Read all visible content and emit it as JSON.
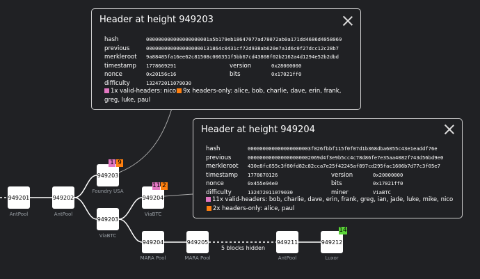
{
  "colors": {
    "pink": "#e377c2",
    "orange": "#ff7f0e",
    "green": "#5cd63a",
    "bg": "#202124"
  },
  "nodes": [
    {
      "id": "n1",
      "height": "949201",
      "miner": "AntPool"
    },
    {
      "id": "n2",
      "height": "949202",
      "miner": "AntPool"
    },
    {
      "id": "n3",
      "height": "949203",
      "miner": "Foundry USA"
    },
    {
      "id": "n4",
      "height": "949203",
      "miner": "ViaBTC"
    },
    {
      "id": "n5",
      "height": "949204",
      "miner": "ViaBTC"
    },
    {
      "id": "n6",
      "height": "949204",
      "miner": "MARA Pool"
    },
    {
      "id": "n7",
      "height": "949205",
      "miner": "MARA Pool"
    },
    {
      "id": "n8",
      "height": "949211",
      "miner": "AntPool"
    },
    {
      "id": "n9",
      "height": "949212",
      "miner": "Luxor"
    }
  ],
  "badges": {
    "n3": [
      "1",
      "9"
    ],
    "n5": [
      "11",
      "2"
    ],
    "n9": [
      "14"
    ]
  },
  "hidden_label": "5 blocks hidden",
  "panel1": {
    "title": "Header at height 949203",
    "hash": "000000000000000000001a5b179eb18647077ad78072ab0a171dd4686d4058069",
    "previous": "0000000000000000000131864c0431cf72d938ab620e7a1d6c0f27dcc12c28b7",
    "merkleroot": "9a88485fa16ee62c81508c006351f5bb67cd43808f02b2162a4d1294e52b2dbd",
    "timestamp": "1778669291",
    "version": "0x28000000",
    "nonce": "0x20156c16",
    "bits": "0x17021ff0",
    "difficulty": "132472011079030",
    "summary_a": "1x valid-headers: nico",
    "summary_b": "9x headers-only: alice, bob, charlie, dave, erin, frank, greg, luke, paul"
  },
  "panel2": {
    "title": "Header at height 949204",
    "hash": "000000000000000000003f026fbbf115f0f07d1b368dba6055c43e1eaddf76e",
    "previous": "000000000000000000002069d4f3e9b5cc4c78d86fe7e35aa4082f743d56bd9e0",
    "merkleroot": "430e8fc655c3f80fd82c82cca7e25f42245af897cd295fac1606b7d77c3f05e7",
    "timestamp": "1778670126",
    "version": "0x20000000",
    "nonce": "0x455e94e0",
    "bits": "0x17021ff0",
    "difficulty": "132472011079030",
    "miner": "ViaBTC",
    "summary_a": "11x valid-headers: bob, charlie, dave, erin, frank, greg, ian, jade, luke, mike, nico",
    "summary_b": "2x headers-only: alice, paul"
  },
  "labels": {
    "hash": "hash",
    "previous": "previous",
    "merkleroot": "merkleroot",
    "timestamp": "timestamp",
    "version": "version",
    "nonce": "nonce",
    "bits": "bits",
    "difficulty": "difficulty",
    "miner": "miner"
  }
}
